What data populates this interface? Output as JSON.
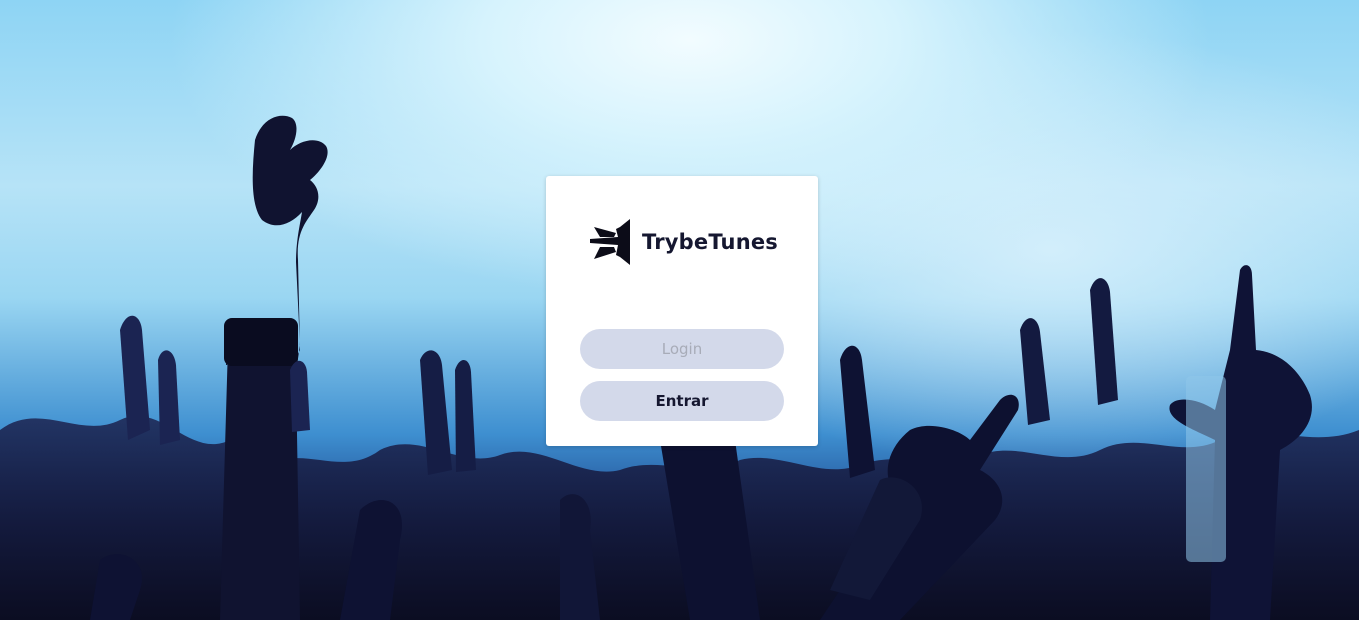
{
  "app": {
    "brand_name": "TrybeTunes",
    "logo_icon": "trybetunes-logo-icon",
    "background": "concert-crowd-hands-raised"
  },
  "login_form": {
    "login_input_value": "",
    "login_input_placeholder": "Login",
    "enter_button_label": "Entrar"
  },
  "colors": {
    "card_background": "#ffffff",
    "button_background": "#d3d9ea",
    "brand_text": "#151730",
    "placeholder_text": "#a8acb8"
  }
}
